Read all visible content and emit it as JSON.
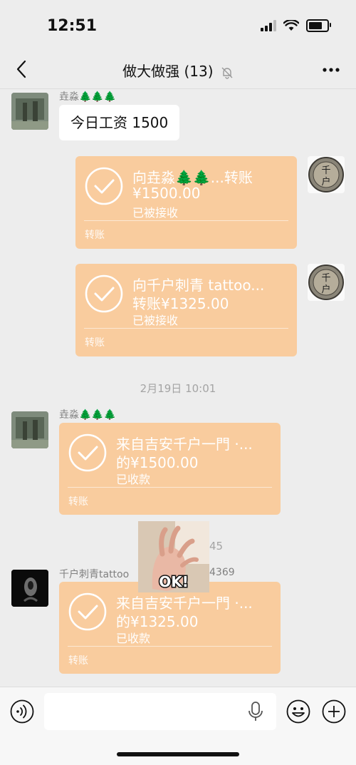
{
  "status_bar": {
    "time": "12:51"
  },
  "nav": {
    "title": "做大做强 (13)"
  },
  "messages": {
    "m1": {
      "sender": "垚淼🌲🌲🌲",
      "text": "今日工资 1500"
    },
    "t1": {
      "line1": "向垚淼🌲🌲...转账",
      "line2": "¥1500.00",
      "status": "已被接收",
      "footer": "转账"
    },
    "t2": {
      "line1": "向千户刺青 tattoo...",
      "line2": "转账¥1325.00",
      "status": "已被接收",
      "footer": "转账"
    },
    "ts1": "2月19日 10:01",
    "t3": {
      "sender": "垚淼🌲🌲🌲",
      "line1": "来自吉安千户一門 ·...",
      "line2": "的¥1500.00",
      "status": "已收款",
      "footer": "转账"
    },
    "partial_time": "45",
    "t4": {
      "sender": "千户刺青tattoo",
      "sender_tail": "4369",
      "line1": "来自吉安千户一門 ·...",
      "line2": "的¥1325.00",
      "status": "已收款",
      "footer": "转账"
    }
  },
  "sticker": {
    "text": "OK!"
  },
  "avatars": {
    "coin_text_top": "千",
    "coin_text_bottom": "户"
  },
  "colors": {
    "transfer": "#f9cc9e",
    "background": "#ededed"
  }
}
